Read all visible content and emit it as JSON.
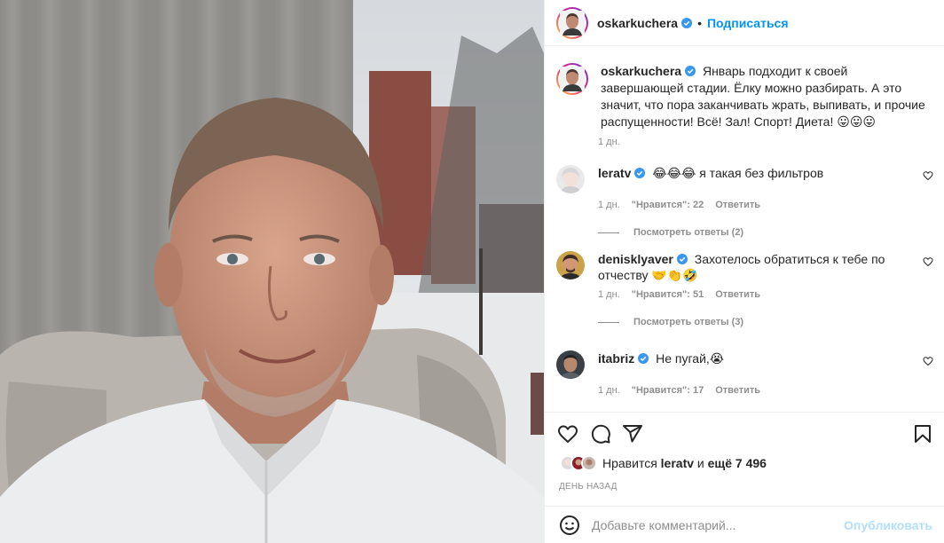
{
  "header": {
    "username": "oskarkucherа",
    "follow_label": "Подписаться",
    "separator": "•"
  },
  "caption": {
    "username": "oskarkucherа",
    "text": "Январь подходит к своей завершающей стадии. Ёлку можно разбирать. А это значит, что пора заканчивать жрать, выпивать, и прочие распущенности! Всё! Зал! Спорт! Диета! 😛😛😛",
    "time": "1 дн."
  },
  "comments": [
    {
      "username": "leratv",
      "text": "😂😂😂 я такая без фильтров",
      "time": "1 дн.",
      "likes": "\"Нравится\": 22",
      "reply_label": "Ответить",
      "view_replies": "Посмотреть ответы (2)"
    },
    {
      "username": "denisklyaver",
      "text": "Захотелось обратиться к тебе по отчеству 🤝👏🤣",
      "time": "1 дн.",
      "likes": "\"Нравится\": 51",
      "reply_label": "Ответить",
      "view_replies": "Посмотреть ответы (3)"
    },
    {
      "username": "itabriz",
      "text": "Не пугай,😭",
      "time": "1 дн.",
      "likes": "\"Нравится\": 17",
      "reply_label": "Ответить"
    }
  ],
  "likes": {
    "prefix": "Нравится",
    "user": "leratv",
    "middle": "и",
    "count": "ещё 7 496"
  },
  "posted": "ДЕНЬ НАЗАД",
  "add_comment": {
    "placeholder": "Добавьте комментарий...",
    "publish_label": "Опубликовать"
  },
  "icons": {
    "like": "heart-icon",
    "comment": "comment-icon",
    "share": "paper-plane-icon",
    "save": "bookmark-icon",
    "emoji": "smiley-icon",
    "verified": "verified-badge-icon"
  },
  "colors": {
    "accent": "#0095f6",
    "publish_disabled": "#b2dffc",
    "verified": "#3897f0",
    "muted": "#8e8e8e"
  }
}
